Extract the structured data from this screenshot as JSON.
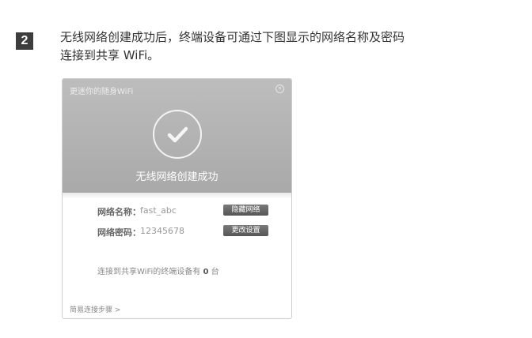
{
  "step": {
    "number": "2",
    "line1": "无线网络创建成功后，终端设备可通过下图显示的网络名称及密码",
    "line2": "连接到共享 WiFi。"
  },
  "dialog": {
    "title": "更迷你的随身WiFi",
    "close_icon": "close-icon",
    "status_icon": "checkmark-circle-icon",
    "success_message": "无线网络创建成功",
    "network_name_label": "网络名称：",
    "network_name_value": "fast_abc",
    "hide_network_button": "隐藏网络",
    "password_label": "网络密码：",
    "password_value": "12345678",
    "change_settings_button": "更改设置",
    "device_count_prefix": "连接到共享WiFi的终端设备有",
    "device_count": "0",
    "device_count_suffix": "台",
    "steps_link": "简易连接步骤 >"
  },
  "colors": {
    "badge": "#3d3d3d",
    "dialog_header": "#b3b3b3",
    "button": "#666666"
  }
}
